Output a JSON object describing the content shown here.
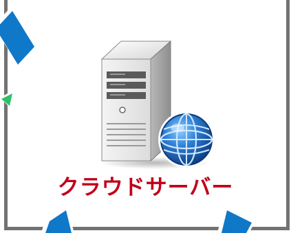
{
  "node": {
    "label": "クラウドサーバー",
    "icon": "server-with-globe-icon"
  },
  "colors": {
    "frame": "#727272",
    "label": "#c0001a",
    "arrow_blue": "#0f78c8",
    "arrow_green": "#2fbf6a",
    "globe_blue": "#1f5fb0",
    "server_grey": "#e6e6e6"
  },
  "arrows": [
    {
      "name": "top-left-arrow",
      "direction": "pointing-left"
    },
    {
      "name": "green-arrow-tip",
      "direction": "pointing-left"
    },
    {
      "name": "bottom-left-arrow",
      "direction": "pointing-up"
    },
    {
      "name": "bottom-right-arrow",
      "direction": "pointing-up"
    }
  ]
}
